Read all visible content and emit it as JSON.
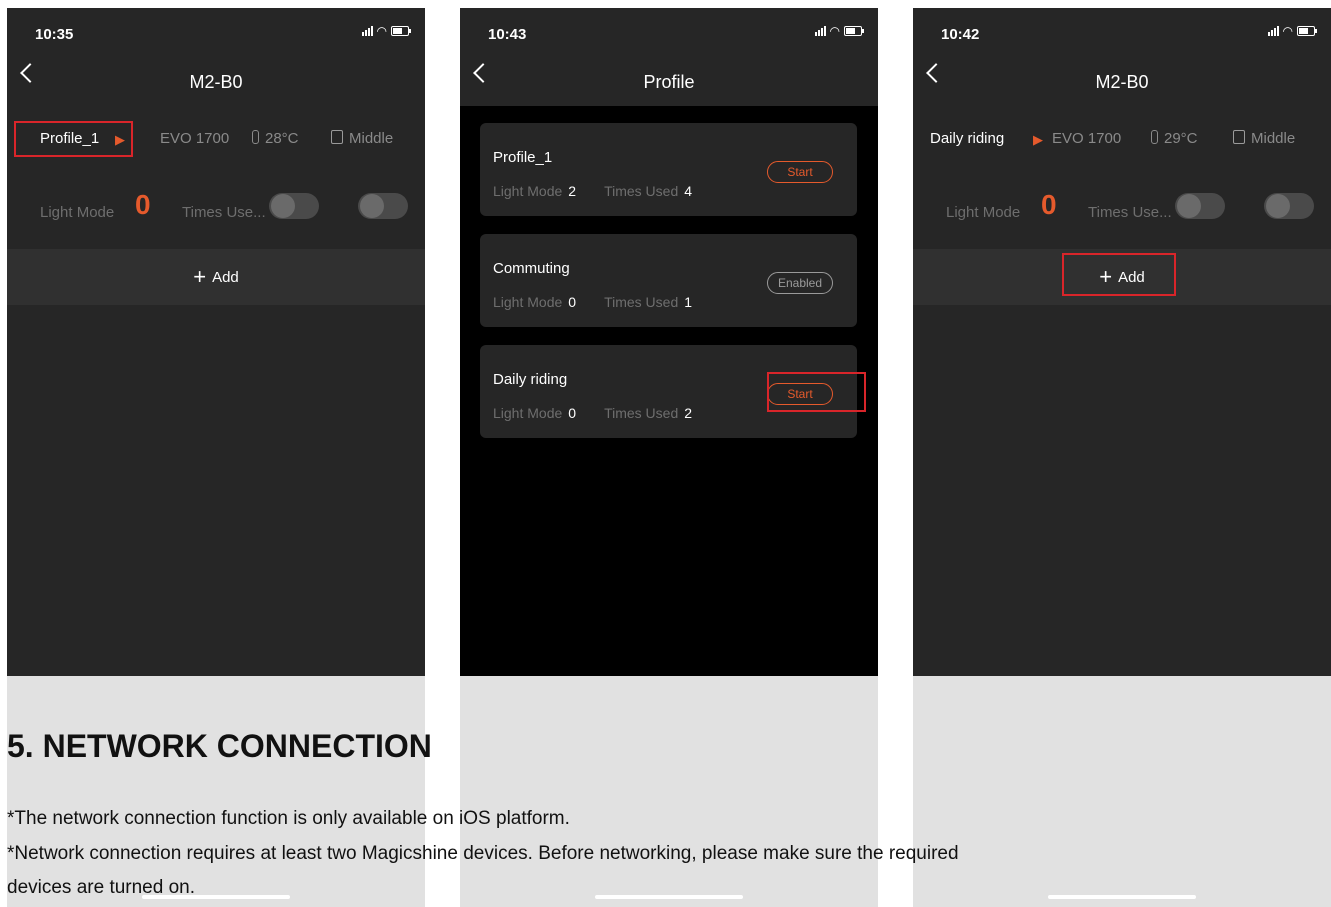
{
  "screens": [
    {
      "time": "10:35",
      "title": "M2-B0",
      "profile_name": "Profile_1",
      "model": "EVO 1700",
      "temperature": "28°C",
      "battery_level": "Middle",
      "light_mode_label": "Light Mode",
      "light_mode_value": "0",
      "times_used_label": "Times Use...",
      "add_label": "Add"
    },
    {
      "time": "10:43",
      "title": "Profile",
      "profiles": [
        {
          "name": "Profile_1",
          "light_mode_label": "Light Mode",
          "light_mode": "2",
          "times_used_label": "Times Used",
          "times_used": "4",
          "action": "Start"
        },
        {
          "name": "Commuting",
          "light_mode_label": "Light Mode",
          "light_mode": "0",
          "times_used_label": "Times Used",
          "times_used": "1",
          "action": "Enabled"
        },
        {
          "name": "Daily riding",
          "light_mode_label": "Light Mode",
          "light_mode": "0",
          "times_used_label": "Times Used",
          "times_used": "2",
          "action": "Start"
        }
      ]
    },
    {
      "time": "10:42",
      "title": "M2-B0",
      "profile_name": "Daily riding",
      "model": "EVO 1700",
      "temperature": "29°C",
      "battery_level": "Middle",
      "light_mode_label": "Light Mode",
      "light_mode_value": "0",
      "times_used_label": "Times Use...",
      "add_label": "Add"
    }
  ],
  "document": {
    "heading": "5. NETWORK CONNECTION",
    "line1": "*The network connection function is only available on iOS platform.",
    "line2": "*Network connection requires at least two Magicshine devices. Before networking, please make sure the required",
    "line3": "devices are turned on."
  },
  "colors": {
    "accent": "#e55a2c",
    "highlight_box": "#d9252a",
    "screen_bg": "#262626"
  },
  "icons": [
    "back-chevron-icon",
    "play-arrow-icon",
    "thermometer-icon",
    "lock-icon",
    "plus-icon",
    "signal-icon",
    "wifi-icon",
    "battery-icon"
  ]
}
